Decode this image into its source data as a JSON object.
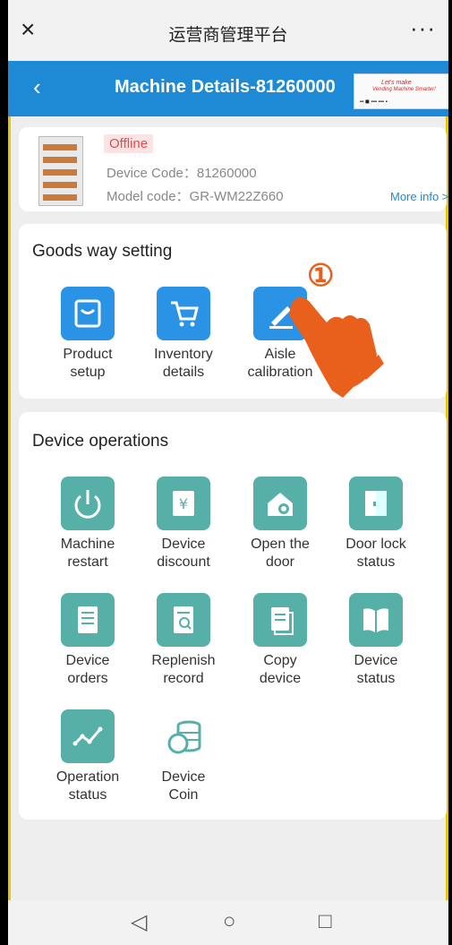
{
  "window": {
    "close_icon": "×",
    "title": "运营商管理平台",
    "more_icon": "···"
  },
  "navbar": {
    "back_icon": "‹",
    "title": "Machine Details-81260000"
  },
  "ad": {
    "line1": "Let's make",
    "line2": "Vending Machine Smarter!",
    "line3": "▪▪ ◼ ▪▪▪ ▪▪▪ ▪"
  },
  "machine": {
    "status": "Offline",
    "device_code": "Device Code：81260000",
    "model_code": "Model code：GR-WM22Z660",
    "more_info": "More info >>"
  },
  "goods": {
    "title": "Goods way setting",
    "items": [
      {
        "label1": "Product",
        "label2": "setup",
        "icon": "product-setup-icon"
      },
      {
        "label1": "Inventory",
        "label2": "details",
        "icon": "cart-icon"
      },
      {
        "label1": "Aisle",
        "label2": "calibration",
        "icon": "edit-icon"
      }
    ]
  },
  "annotation": {
    "marker": "①"
  },
  "device": {
    "title": "Device operations",
    "items": [
      {
        "label1": "Machine",
        "label2": "restart",
        "icon": "power-icon"
      },
      {
        "label1": "Device",
        "label2": "discount",
        "icon": "discount-icon"
      },
      {
        "label1": "Open the",
        "label2": "door",
        "icon": "home-key-icon"
      },
      {
        "label1": "Door lock",
        "label2": "status",
        "icon": "door-icon"
      },
      {
        "label1": "Device",
        "label2": "orders",
        "icon": "orders-icon"
      },
      {
        "label1": "Replenish",
        "label2": "record",
        "icon": "record-icon"
      },
      {
        "label1": "Copy",
        "label2": "device",
        "icon": "copy-icon"
      },
      {
        "label1": "Device",
        "label2": "status",
        "icon": "book-icon"
      },
      {
        "label1": "Operation",
        "label2": "status",
        "icon": "chart-icon"
      },
      {
        "label1": "Device",
        "label2": "Coin",
        "icon": "coin-icon"
      }
    ]
  },
  "system_nav": {
    "back": "◁",
    "home": "○",
    "recent": "□"
  },
  "colors": {
    "primary": "#1e8ad6",
    "teal": "#57b0a7",
    "offline": "#e34a4a",
    "hand": "#e8601c"
  }
}
